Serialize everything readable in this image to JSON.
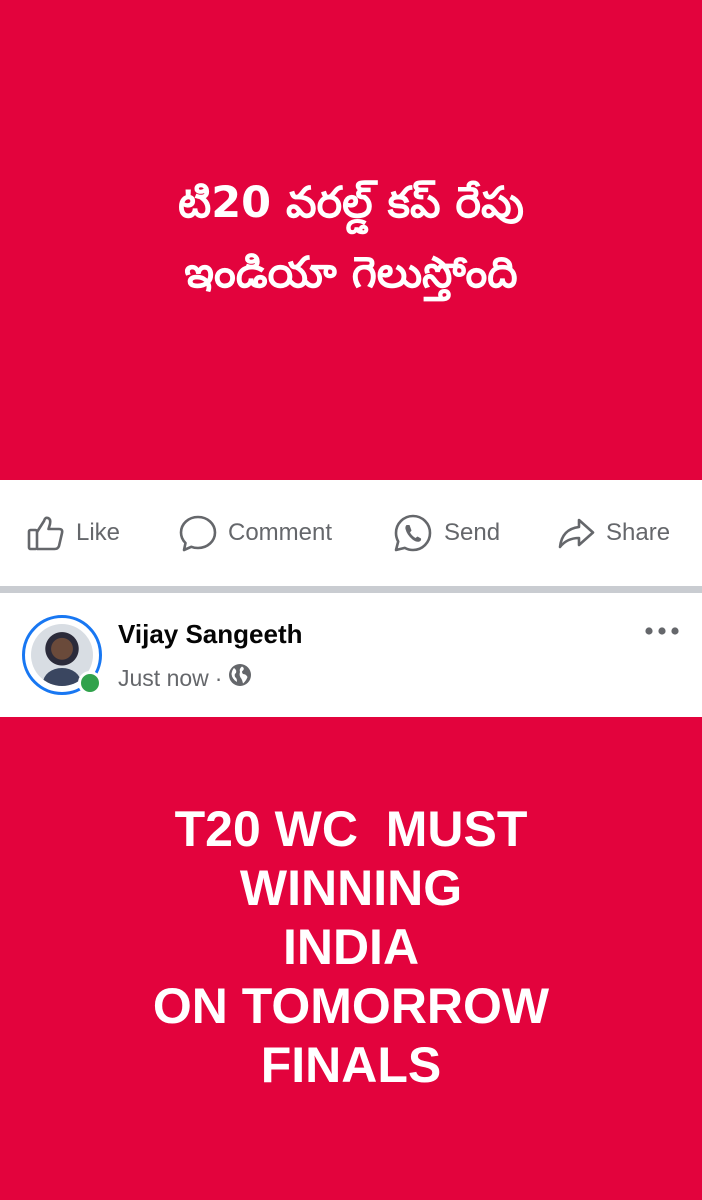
{
  "post_top": {
    "text_lines": [
      "టి20 వరల్డ్ కప్ రేపు",
      "ఇండియా గెలుస్తోంది"
    ],
    "background": "#e3033d"
  },
  "actions": {
    "like": {
      "label": "Like",
      "icon": "like-icon"
    },
    "comment": {
      "label": "Comment",
      "icon": "comment-icon"
    },
    "send": {
      "label": "Send",
      "icon": "whatsapp-icon"
    },
    "share": {
      "label": "Share",
      "icon": "share-icon"
    }
  },
  "post": {
    "author": "Vijay Sangeeth",
    "time": "Just now",
    "separator": "·",
    "privacy_icon": "globe-icon",
    "online": true,
    "text_lines": [
      "T20 WC  MUST",
      "WINNING",
      "INDIA",
      "ON TOMORROW",
      "FINALS"
    ],
    "background": "#e3033d"
  },
  "colors": {
    "accent": "#1877f2",
    "online": "#31a24c",
    "secondary_text": "#65676b"
  }
}
